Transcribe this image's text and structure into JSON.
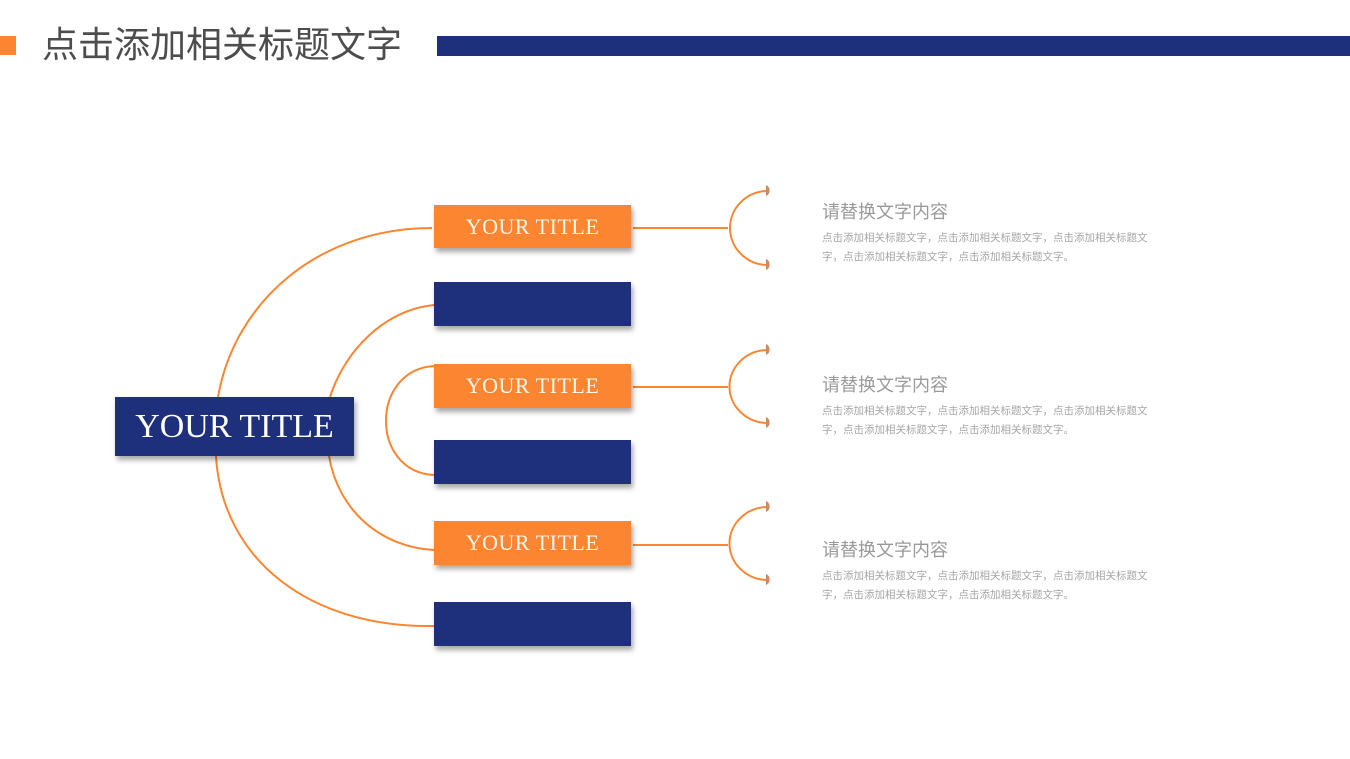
{
  "header": {
    "title": "点击添加相关标题文字"
  },
  "colors": {
    "orange": "#fb8531",
    "navy": "#1e307b",
    "title_text": "#4d4d4d",
    "desc_title": "#9a9a9a",
    "desc_body": "#a6a6a6"
  },
  "diagram": {
    "main_title": "YOUR TITLE",
    "branches": [
      {
        "title": "YOUR TITLE",
        "desc_title": "请替换文字内容",
        "desc_body": "点击添加相关标题文字，点击添加相关标题文字，点击添加相关标题文字，点击添加相关标题文字，点击添加相关标题文字。"
      },
      {
        "title": "YOUR TITLE",
        "desc_title": "请替换文字内容",
        "desc_body": "点击添加相关标题文字，点击添加相关标题文字，点击添加相关标题文字，点击添加相关标题文字，点击添加相关标题文字。"
      },
      {
        "title": "YOUR TITLE",
        "desc_title": "请替换文字内容",
        "desc_body": "点击添加相关标题文字，点击添加相关标题文字，点击添加相关标题文字，点击添加相关标题文字，点击添加相关标题文字。"
      }
    ],
    "blank_boxes": 3
  }
}
